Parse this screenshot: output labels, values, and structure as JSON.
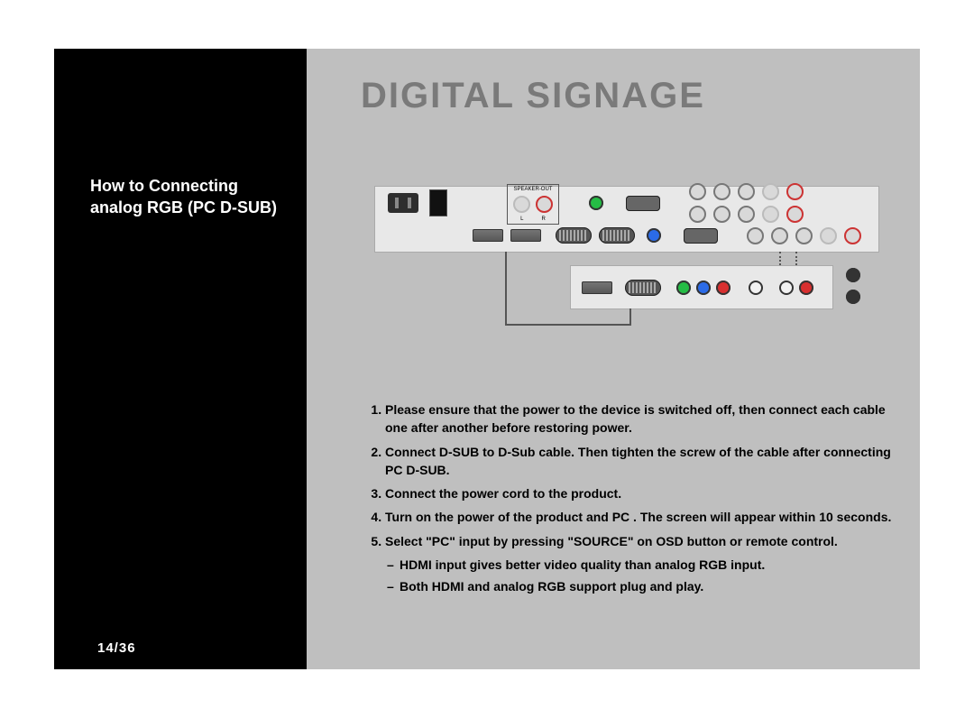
{
  "header": {
    "title": "DIGITAL SIGNAGE"
  },
  "section": {
    "title": "How to Connecting analog RGB (PC D-SUB)"
  },
  "illustration": {
    "speaker_out_label": "SPEAKER-OUT",
    "speaker_l": "L",
    "speaker_r": "R"
  },
  "steps": [
    "Please ensure that the power to the device is switched off, then connect each cable one after another before restoring power.",
    "Connect D-SUB to D-Sub cable. Then tighten the screw of the cable after connecting PC D-SUB.",
    "Connect the power cord to the product.",
    "Turn on the power of the product and PC . The screen will appear within 10 seconds.",
    "Select \"PC\" input by pressing \"SOURCE\" on OSD button or remote control."
  ],
  "notes": [
    "HDMI input gives better video quality than analog RGB input.",
    "Both HDMI and analog RGB support plug and play."
  ],
  "pager": {
    "label": "14/36"
  }
}
